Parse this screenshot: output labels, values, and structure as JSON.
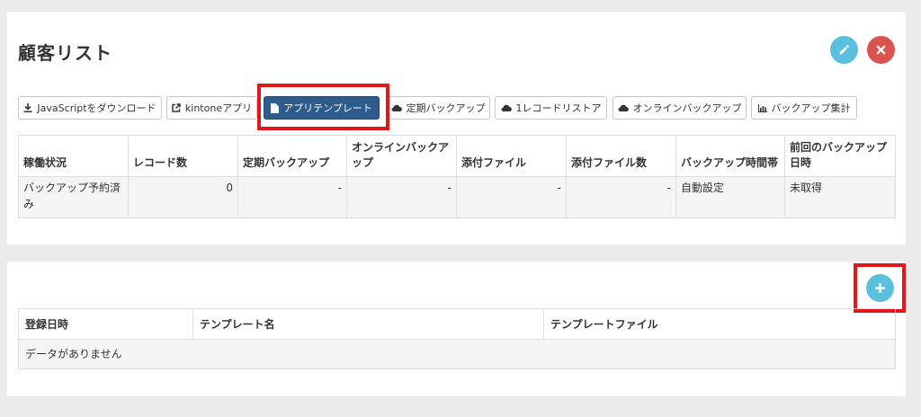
{
  "header": {
    "title": "顧客リスト",
    "edit_icon": "pencil-icon",
    "close_icon": "times-icon"
  },
  "toolbar": {
    "buttons": [
      {
        "label": "JavaScriptをダウンロード",
        "icon": "download-icon"
      },
      {
        "label": "kintoneアプリ",
        "icon": "external-link-icon"
      },
      {
        "label": "アプリテンプレート",
        "icon": "file-icon",
        "active": true
      },
      {
        "label": "定期バックアップ",
        "icon": "cloud-icon"
      },
      {
        "label": "1レコードリストア",
        "icon": "cloud-icon"
      },
      {
        "label": "オンラインバックアップ",
        "icon": "cloud-icon"
      },
      {
        "label": "バックアップ集計",
        "icon": "bar-chart-icon"
      }
    ]
  },
  "status_table": {
    "headers": [
      "稼働状況",
      "レコード数",
      "定期バックアップ",
      "オンラインバックアップ",
      "添付ファイル",
      "添付ファイル数",
      "バックアップ時間帯",
      "前回のバックアップ日時"
    ],
    "row": [
      "バックアップ予約済み",
      "0",
      "-",
      "-",
      "-",
      "-",
      "自動設定",
      "未取得"
    ]
  },
  "template_section": {
    "add_icon": "plus-icon",
    "headers": [
      "登録日時",
      "テンプレート名",
      "テンプレートファイル"
    ],
    "empty_message": "データがありません"
  },
  "colors": {
    "primary": "#2c5b8c",
    "info": "#5bc0de",
    "danger": "#d9534f",
    "highlight": "#e2161d"
  }
}
